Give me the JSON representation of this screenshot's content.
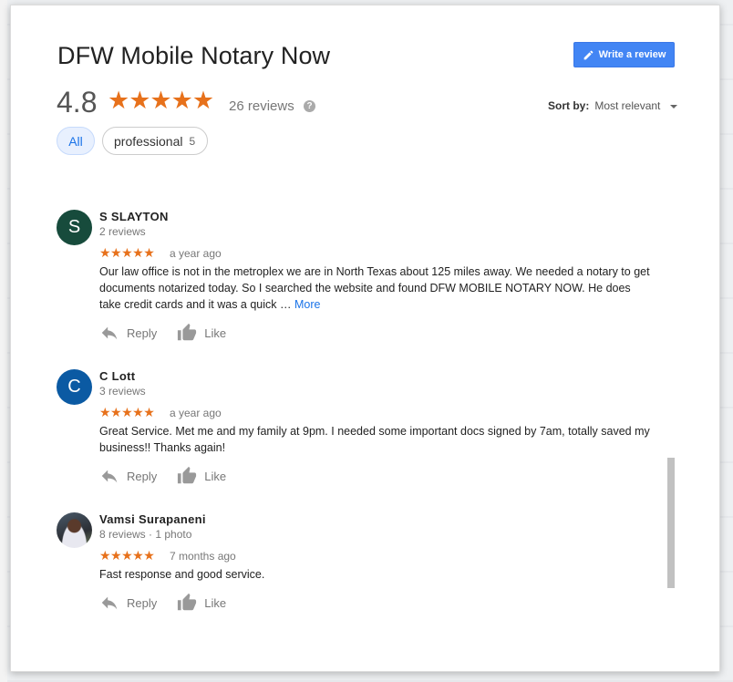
{
  "business": {
    "name": "DFW Mobile Notary Now"
  },
  "write_review": {
    "label": "Write a review"
  },
  "summary": {
    "rating": "4.8",
    "stars": "★★★★★",
    "count_text": "26 reviews",
    "help_glyph": "?"
  },
  "sort": {
    "label": "Sort by:",
    "value": "Most relevant"
  },
  "filters": {
    "all": "All",
    "professional_label": "professional",
    "professional_count": "5"
  },
  "reviews": [
    {
      "initial": "S",
      "avatar_color": "#174b3c",
      "name": "S SLAYTON",
      "meta": "2 reviews",
      "stars": "★★★★★",
      "time": "a year ago",
      "text": "Our law office is not in the metroplex we are in North Texas about 125 miles away. We needed a notary to get documents notarized today. So I searched the website and found DFW MOBILE NOTARY NOW. He does take credit cards and it was a quick … ",
      "more": "More"
    },
    {
      "initial": "C",
      "avatar_color": "#0b5aa3",
      "name": "C Lott",
      "meta": "3 reviews",
      "stars": "★★★★★",
      "time": "a year ago",
      "text": "Great Service. Met me and my family at 9pm. I needed some important docs signed by 7am, totally saved my business!! Thanks again!"
    },
    {
      "name": "Vamsi Surapaneni",
      "meta": "8 reviews · 1 photo",
      "stars": "★★★★★",
      "time": "7 months ago",
      "text": "Fast response and good service."
    }
  ],
  "actions": {
    "reply": "Reply",
    "like": "Like"
  },
  "colors": {
    "accent": "#4285f4",
    "star": "#e7711b",
    "link": "#1a73e8"
  }
}
